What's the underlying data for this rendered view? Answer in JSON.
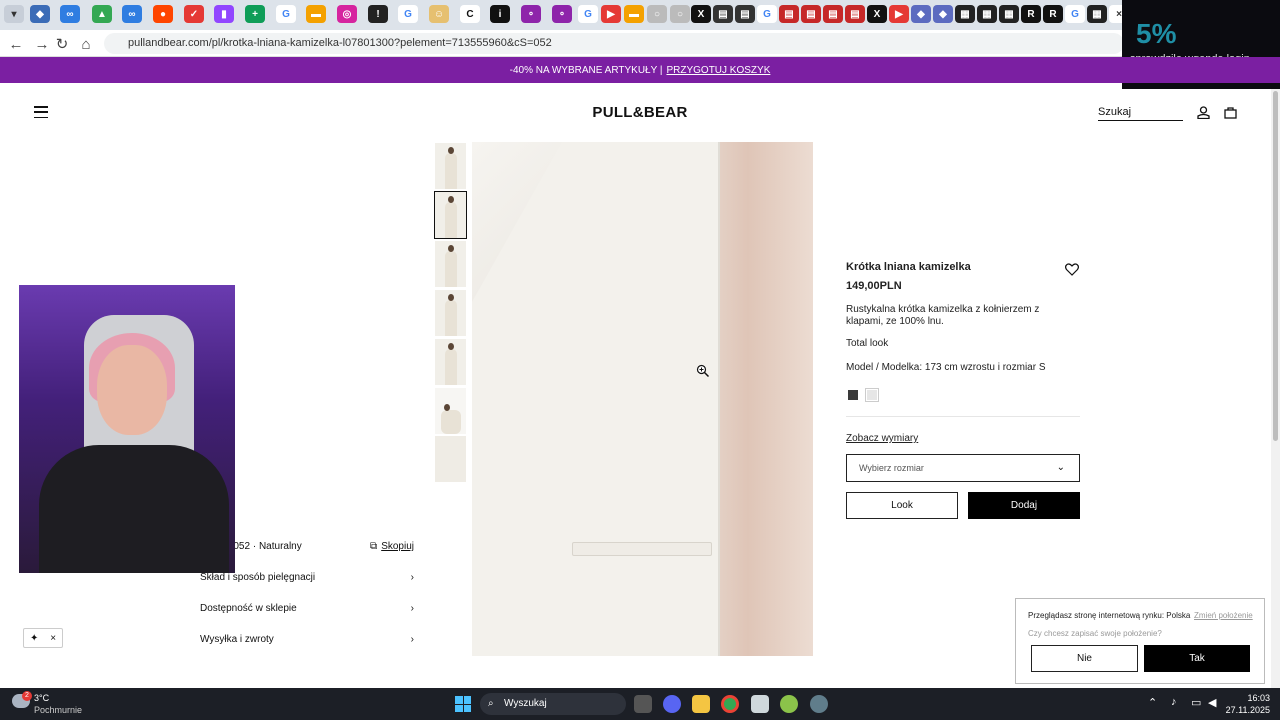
{
  "browser": {
    "url": "pullandbear.com/pl/krotka-lniana-kamizelka-l07801300?pelement=713555960&cS=052",
    "tabs": [
      "tab",
      "tab",
      "tab",
      "tab",
      "tab",
      "tab",
      "tab",
      "tab",
      "tab",
      "tab",
      "tab",
      "tab",
      "tab",
      "tab",
      "tab",
      "tab",
      "tab",
      "tab",
      "tab",
      "tab",
      "tab",
      "tab",
      "tab",
      "tab",
      "tab",
      "tab",
      "tab",
      "tab",
      "tab",
      "tab",
      "tab",
      "tab",
      "tab",
      "tab",
      "tab",
      "tab",
      "tab",
      "tab",
      "tab",
      "tab",
      "tab",
      "tab",
      "tab",
      "tab",
      "tab",
      "tab",
      "tab",
      "tab",
      "tab",
      "tab",
      "tab"
    ],
    "overlay": {
      "big": "5%",
      "text": "sprawdzile wgende login"
    }
  },
  "promo": {
    "text": "-40% NA WYBRANE ARTYKUŁY |",
    "link": "PRZYGOTUJ KOSZYK"
  },
  "header": {
    "logo": "PULL&BEAR",
    "search": "Szukaj"
  },
  "product": {
    "name": "Krótka lniana kamizelka",
    "price": "149,00PLN",
    "description": "Rustykalna krótka kamizelka z kołnierzem z klapami, ze 100% lnu.",
    "total_look": "Total look",
    "model": "Model / Modelka: 173 cm wzrostu i rozmiar S",
    "swatch_colors": [
      "#3a3a3a",
      "#e6e6e6"
    ],
    "size_link": "Zobacz wymiary",
    "size_placeholder": "Wybierz rozmiar",
    "look_button": "Look",
    "add_button": "Dodaj"
  },
  "info": {
    "ref": "801300052 · Naturalny",
    "copy": "Skopiuj",
    "accordions": [
      "Skład i sposób pielęgnacji",
      "Dostępność w sklepie",
      "Wysyłka i zwroty"
    ]
  },
  "cookie": {
    "market": "Przeglądasz stronę internetową rynku: Polska",
    "change": "Zmień położenie",
    "question": "Czy chcesz zapisać swoje położenie?",
    "no": "Nie",
    "yes": "Tak"
  },
  "taskbar": {
    "weather_temp": "3°C",
    "weather_desc": "Pochmurnie",
    "search": "Wyszukaj",
    "time": "16:03",
    "date": "27.11.2025",
    "badge": "2"
  }
}
